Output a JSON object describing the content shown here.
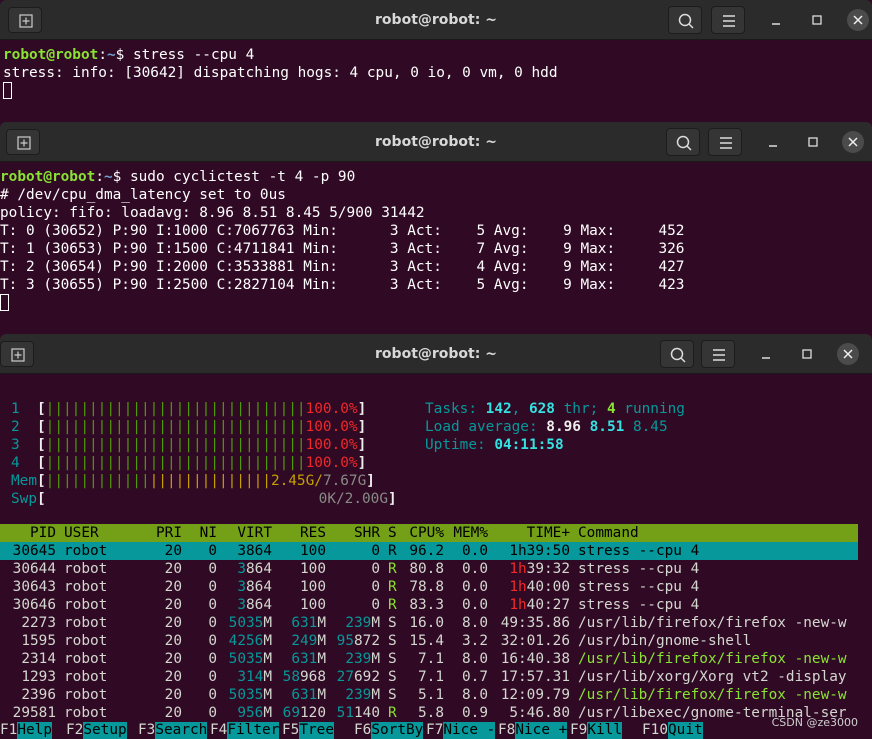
{
  "colors": {
    "terminal_bg": "#300a24",
    "titlebar_bg": "#2b2b2b",
    "prompt_user": "#8ae234",
    "prompt_path": "#729fcf",
    "htop_header": "#73a016",
    "htop_select": "#06989a"
  },
  "windows": [
    {
      "title": "robot@robot: ~",
      "prompt_user": "robot@robot",
      "prompt_sep": ":",
      "prompt_path": "~",
      "prompt_sym": "$ ",
      "command": "stress --cpu 4",
      "output": [
        "stress: info: [30642] dispatching hogs: 4 cpu, 0 io, 0 vm, 0 hdd"
      ]
    },
    {
      "title": "robot@robot: ~",
      "prompt_user": "robot@robot",
      "prompt_sep": ":",
      "prompt_path": "~",
      "prompt_sym": "$ ",
      "command": "sudo cyclictest -t 4 -p 90",
      "output": [
        "# /dev/cpu_dma_latency set to 0us",
        "policy: fifo: loadavg: 8.96 8.51 8.45 5/900 31442",
        "",
        "T: 0 (30652) P:90 I:1000 C:7067763 Min:      3 Act:    5 Avg:    9 Max:     452",
        "T: 1 (30653) P:90 I:1500 C:4711841 Min:      3 Act:    7 Avg:    9 Max:     326",
        "T: 2 (30654) P:90 I:2000 C:3533881 Min:      3 Act:    4 Avg:    9 Max:     427",
        "T: 3 (30655) P:90 I:2500 C:2827104 Min:      3 Act:    5 Avg:    9 Max:     423"
      ]
    },
    {
      "title": "robot@robot: ~"
    }
  ],
  "htop": {
    "cpus": [
      {
        "id": "1",
        "bar": "||||||||||||||||||||||||||||||",
        "pct": "100.0%"
      },
      {
        "id": "2",
        "bar": "||||||||||||||||||||||||||||||",
        "pct": "100.0%"
      },
      {
        "id": "3",
        "bar": "||||||||||||||||||||||||||||||",
        "pct": "100.0%"
      },
      {
        "id": "4",
        "bar": "||||||||||||||||||||||||||||||",
        "pct": "100.0%"
      }
    ],
    "mem": {
      "label": "Mem",
      "bar_green": "||||||||||||",
      "bar_yellow": "||||||||||||||",
      "used": "2.45G",
      "sep": "/",
      "total": "7.67G"
    },
    "swp": {
      "label": "Swp",
      "used": "0K",
      "sep": "/",
      "total": "2.00G"
    },
    "tasks": {
      "label": "Tasks: ",
      "count": "142",
      "comma": ", ",
      "thr": "628",
      "thr_label": " thr; ",
      "running": "4",
      "running_label": " running"
    },
    "load": {
      "label": "Load average: ",
      "l1": "8.96",
      "l5": "8.51",
      "l15": "8.45"
    },
    "uptime": {
      "label": "Uptime: ",
      "value": "04:11:58"
    },
    "columns": [
      "PID",
      "USER",
      "PRI",
      "NI",
      "VIRT",
      "RES",
      "SHR",
      "S",
      "CPU%",
      "MEM%",
      "TIME+",
      "Command"
    ],
    "rows": [
      [
        "30645",
        "robot",
        "20",
        "0",
        "3864",
        "100",
        "0",
        "R",
        "96.2",
        "0.0",
        "1h39:50",
        "stress --cpu 4"
      ],
      [
        "30644",
        "robot",
        "20",
        "0",
        "3864",
        "100",
        "0",
        "R",
        "80.8",
        "0.0",
        "1h39:32",
        "stress --cpu 4"
      ],
      [
        "30643",
        "robot",
        "20",
        "0",
        "3864",
        "100",
        "0",
        "R",
        "78.8",
        "0.0",
        "1h40:00",
        "stress --cpu 4"
      ],
      [
        "30646",
        "robot",
        "20",
        "0",
        "3864",
        "100",
        "0",
        "R",
        "83.3",
        "0.0",
        "1h40:27",
        "stress --cpu 4"
      ],
      [
        "2273",
        "robot",
        "20",
        "0",
        "5035M",
        "631M",
        "239M",
        "S",
        "16.0",
        "8.0",
        "49:35.86",
        "/usr/lib/firefox/firefox -new-w"
      ],
      [
        "1595",
        "robot",
        "20",
        "0",
        "4256M",
        "249M",
        "95872",
        "S",
        "15.4",
        "3.2",
        "32:01.26",
        "/usr/bin/gnome-shell"
      ],
      [
        "2314",
        "robot",
        "20",
        "0",
        "5035M",
        "631M",
        "239M",
        "S",
        "7.1",
        "8.0",
        "16:40.38",
        "/usr/lib/firefox/firefox -new-w"
      ],
      [
        "1293",
        "robot",
        "20",
        "0",
        "314M",
        "58968",
        "27692",
        "S",
        "7.1",
        "0.7",
        "17:57.31",
        "/usr/lib/xorg/Xorg vt2 -display"
      ],
      [
        "2396",
        "robot",
        "20",
        "0",
        "5035M",
        "631M",
        "239M",
        "S",
        "5.1",
        "8.0",
        "12:09.79",
        "/usr/lib/firefox/firefox -new-w"
      ],
      [
        "29581",
        "robot",
        "20",
        "0",
        "956M",
        "69120",
        "51140",
        "R",
        "5.8",
        "0.9",
        "5:46.80",
        "/usr/libexec/gnome-terminal-ser"
      ]
    ],
    "fkeys": [
      [
        "F1",
        "Help  "
      ],
      [
        "F2",
        "Setup "
      ],
      [
        "F3",
        "Search"
      ],
      [
        "F4",
        "Filter"
      ],
      [
        "F5",
        "Tree  "
      ],
      [
        "F6",
        "SortBy"
      ],
      [
        "F7",
        "Nice -"
      ],
      [
        "F8",
        "Nice +"
      ],
      [
        "F9",
        "Kill  "
      ],
      [
        "F10",
        "Quit  "
      ]
    ]
  },
  "watermark": "CSDN @ze3000"
}
